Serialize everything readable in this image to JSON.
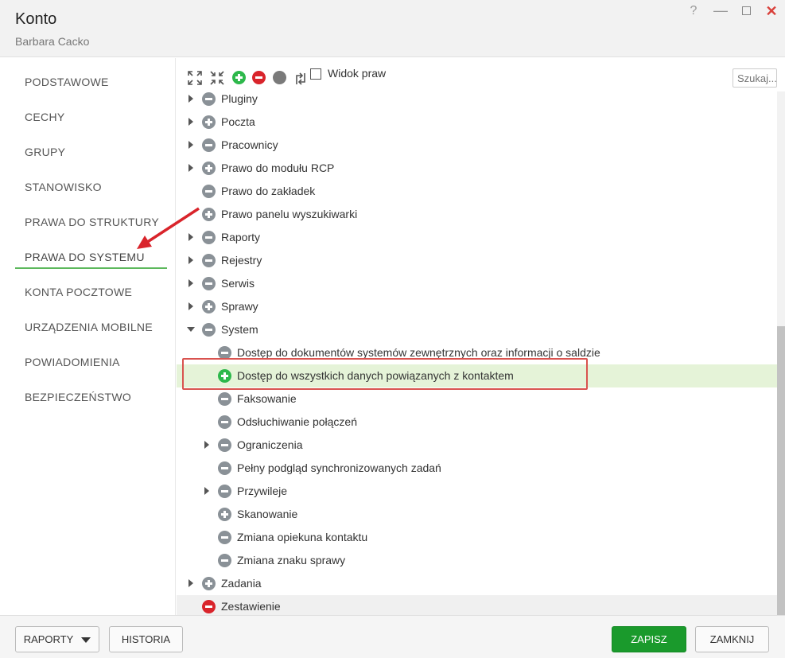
{
  "window": {
    "title": "Konto",
    "subtitle": "Barbara Cacko",
    "help_label": "?",
    "minimize_label": "—",
    "close_label": "✕"
  },
  "sidebar": {
    "items": [
      {
        "label": "PODSTAWOWE"
      },
      {
        "label": "CECHY"
      },
      {
        "label": "GRUPY"
      },
      {
        "label": "STANOWISKO"
      },
      {
        "label": "PRAWA DO STRUKTURY"
      },
      {
        "label": "PRAWA DO SYSTEMU",
        "active": true
      },
      {
        "label": "KONTA POCZTOWE"
      },
      {
        "label": "URZĄDZENIA MOBILNE"
      },
      {
        "label": "POWIADOMIENIA"
      },
      {
        "label": "BEZPIECZEŃSTWO"
      }
    ]
  },
  "toolbar": {
    "expand_icon": "expand-all-icon",
    "collapse_icon": "collapse-all-icon",
    "grant_icon": "grant-all-icon",
    "deny_icon": "deny-all-icon",
    "neutral_icon": "neutral-all-icon",
    "refresh_icon": "refresh-icon",
    "checkbox_label": "Widok praw",
    "search_placeholder": "Szukaj..."
  },
  "tree": {
    "rows": [
      {
        "label": "Pluginy",
        "level": 0,
        "expander": "collapsed",
        "state": "minus"
      },
      {
        "label": "Poczta",
        "level": 0,
        "expander": "collapsed",
        "state": "plus"
      },
      {
        "label": "Pracownicy",
        "level": 0,
        "expander": "collapsed",
        "state": "minus"
      },
      {
        "label": "Prawo do modułu RCP",
        "level": 0,
        "expander": "collapsed",
        "state": "plus"
      },
      {
        "label": "Prawo do zakładek",
        "level": 0,
        "expander": "none",
        "state": "minus"
      },
      {
        "label": "Prawo panelu wyszukiwarki",
        "level": 0,
        "expander": "none",
        "state": "plus"
      },
      {
        "label": "Raporty",
        "level": 0,
        "expander": "collapsed",
        "state": "minus"
      },
      {
        "label": "Rejestry",
        "level": 0,
        "expander": "collapsed",
        "state": "minus"
      },
      {
        "label": "Serwis",
        "level": 0,
        "expander": "collapsed",
        "state": "minus"
      },
      {
        "label": "Sprawy",
        "level": 0,
        "expander": "collapsed",
        "state": "plus"
      },
      {
        "label": "System",
        "level": 0,
        "expander": "expanded",
        "state": "minus"
      },
      {
        "label": "Dostęp do dokumentów systemów zewnętrznych oraz informacji o saldzie",
        "level": 1,
        "expander": "none",
        "state": "minus"
      },
      {
        "label": "Dostęp do wszystkich danych powiązanych z kontaktem",
        "level": 1,
        "expander": "none",
        "state": "plus-green",
        "selected": true
      },
      {
        "label": "Faksowanie",
        "level": 1,
        "expander": "none",
        "state": "minus"
      },
      {
        "label": "Odsłuchiwanie połączeń",
        "level": 1,
        "expander": "none",
        "state": "minus"
      },
      {
        "label": "Ograniczenia",
        "level": 1,
        "expander": "collapsed",
        "state": "minus"
      },
      {
        "label": "Pełny podgląd synchronizowanych zadań",
        "level": 1,
        "expander": "none",
        "state": "minus"
      },
      {
        "label": "Przywileje",
        "level": 1,
        "expander": "collapsed",
        "state": "minus"
      },
      {
        "label": "Skanowanie",
        "level": 1,
        "expander": "none",
        "state": "plus"
      },
      {
        "label": "Zmiana opiekuna kontaktu",
        "level": 1,
        "expander": "none",
        "state": "minus"
      },
      {
        "label": "Zmiana znaku sprawy",
        "level": 1,
        "expander": "none",
        "state": "minus"
      },
      {
        "label": "Zadania",
        "level": 0,
        "expander": "collapsed",
        "state": "plus"
      },
      {
        "label": "Zestawienie",
        "level": 0,
        "expander": "none",
        "state": "minus-red",
        "hover": true
      }
    ]
  },
  "footer": {
    "reports_label": "RAPORTY",
    "history_label": "HISTORIA",
    "save_label": "ZAPISZ",
    "close_label": "ZAMKNIJ"
  },
  "colors": {
    "accent_green": "#2db84b",
    "deny_red": "#d9242b",
    "save_green": "#1a9a2c",
    "selected_row": "#e5f3d8",
    "annotation_red": "#d9534f"
  }
}
